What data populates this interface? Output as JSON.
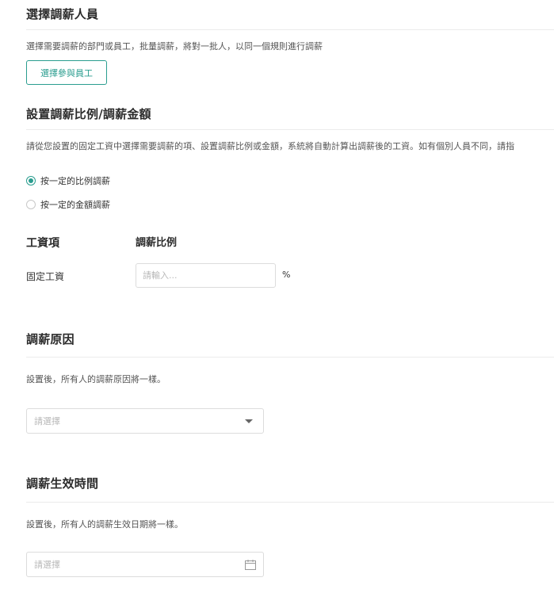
{
  "select_staff": {
    "title": "選擇調薪人員",
    "description": "選擇需要調薪的部門或員工，批量調薪，將對一批人，以同一個規則進行調薪",
    "button_label": "選擇參與員工"
  },
  "adjust_settings": {
    "title": "設置調薪比例/調薪金額",
    "description": "請從您設置的固定工資中選擇需要調薪的項、設置調薪比例或金額，系統將自動計算出調薪後的工資。如有個別人員不同，請指",
    "options": [
      {
        "label": "按一定的比例調薪",
        "selected": true
      },
      {
        "label": "按一定的金額調薪",
        "selected": false
      }
    ],
    "table": {
      "col_item": "工資項",
      "col_ratio": "調薪比例",
      "rows": [
        {
          "item": "固定工資",
          "placeholder": "請輸入...",
          "value": "",
          "unit": "%"
        }
      ]
    }
  },
  "reason": {
    "title": "調薪原因",
    "description": "設置後，所有人的調薪原因將一樣。",
    "select_placeholder": "請選擇"
  },
  "effective_time": {
    "title": "調薪生效時間",
    "description": "設置後，所有人的調薪生效日期將一樣。",
    "date_placeholder": "請選擇"
  },
  "colors": {
    "accent": "#2a9d8f",
    "border": "#dcdcdc",
    "divider": "#ebebeb"
  }
}
